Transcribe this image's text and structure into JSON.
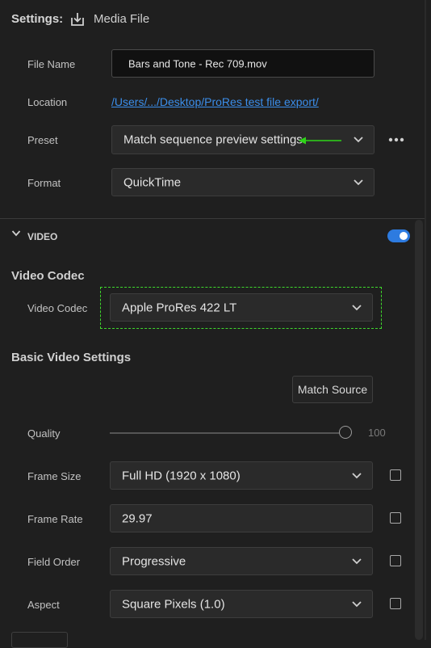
{
  "header": {
    "settings_label": "Settings:",
    "destination_label": "Media File",
    "destination_icon": "download-icon"
  },
  "output": {
    "file_name": {
      "label": "File Name",
      "value": "Bars and Tone - Rec 709.mov"
    },
    "location": {
      "label": "Location",
      "value": "/Users/.../Desktop/ProRes test file export/"
    },
    "preset": {
      "label": "Preset",
      "value": "Match sequence preview settings",
      "arrow_color": "#2ed418"
    },
    "format": {
      "label": "Format",
      "value": "QuickTime"
    }
  },
  "video_section": {
    "title": "VIDEO",
    "enabled": true,
    "toggle_color": "#2d7be0"
  },
  "video_codec": {
    "heading": "Video Codec",
    "label": "Video Codec",
    "value": "Apple ProRes 422 LT",
    "highlight_color": "#3fd92c"
  },
  "basic_settings": {
    "heading": "Basic Video Settings",
    "match_source_label": "Match Source",
    "quality": {
      "label": "Quality",
      "value": "100",
      "level": 1.0
    },
    "frame_size": {
      "label": "Frame Size",
      "value": "Full HD (1920 x 1080)",
      "checked": false
    },
    "frame_rate": {
      "label": "Frame Rate",
      "value": "29.97",
      "checked": false
    },
    "field_order": {
      "label": "Field Order",
      "value": "Progressive",
      "checked": false
    },
    "aspect": {
      "label": "Aspect",
      "value": "Square Pixels (1.0)",
      "checked": false
    }
  },
  "colors": {
    "background": "#1f1f1f",
    "link": "#3b8eea"
  }
}
